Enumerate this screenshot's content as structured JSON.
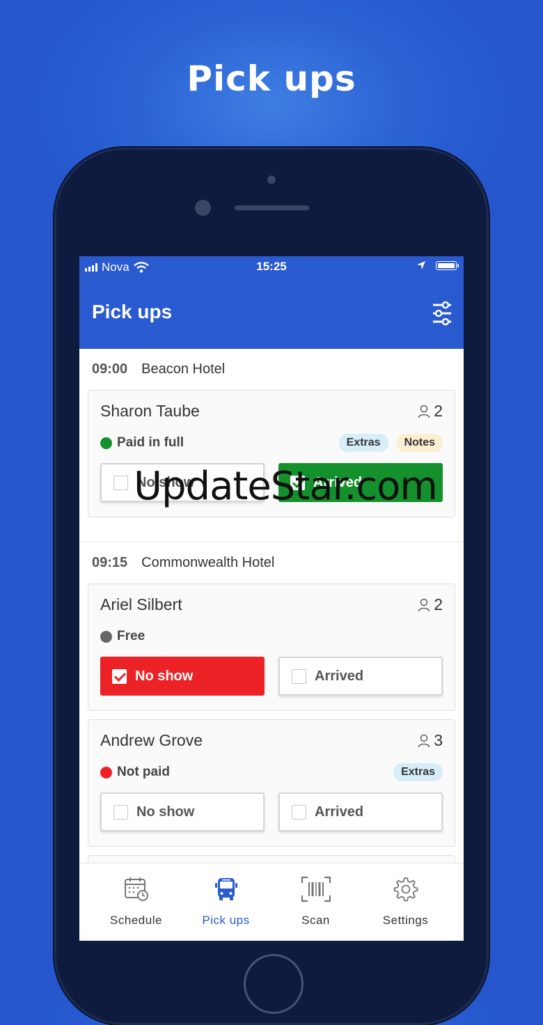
{
  "promo": {
    "title": "Pick ups"
  },
  "status_bar": {
    "carrier": "Nova",
    "time": "15:25"
  },
  "app_bar": {
    "title": "Pick ups",
    "filter_icon": "sliders-icon"
  },
  "colors": {
    "primary": "#2a5ad0",
    "arrived_green": "#14912c",
    "no_show_red": "#ec2227",
    "status_paid": "#14912c",
    "status_free": "#666666",
    "status_not_paid": "#ec2227"
  },
  "sections": [
    {
      "time": "09:00",
      "location": "Beacon Hotel",
      "bookings": [
        {
          "name": "Sharon Taube",
          "pax": "2",
          "status": "Paid in full",
          "tags": [
            "Extras",
            "Notes"
          ],
          "no_show_label": "No show",
          "arrived_label": "Arrived",
          "state": "arrived"
        }
      ]
    },
    {
      "time": "09:15",
      "location": "Commonwealth Hotel",
      "bookings": [
        {
          "name": "Ariel Silbert",
          "pax": "2",
          "status": "Free",
          "tags": [],
          "no_show_label": "No show",
          "arrived_label": "Arrived",
          "state": "no_show"
        },
        {
          "name": "Andrew Grove",
          "pax": "3",
          "status": "Not paid",
          "tags": [
            "Extras"
          ],
          "no_show_label": "No show",
          "arrived_label": "Arrived",
          "state": "none"
        }
      ]
    }
  ],
  "bottom_nav": [
    {
      "label": "Schedule",
      "icon": "calendar-clock-icon",
      "active": false
    },
    {
      "label": "Pick ups",
      "icon": "bus-icon",
      "active": true
    },
    {
      "label": "Scan",
      "icon": "barcode-scan-icon",
      "active": false
    },
    {
      "label": "Settings",
      "icon": "gear-icon",
      "active": false
    }
  ],
  "watermark": "UpdateStar.com"
}
